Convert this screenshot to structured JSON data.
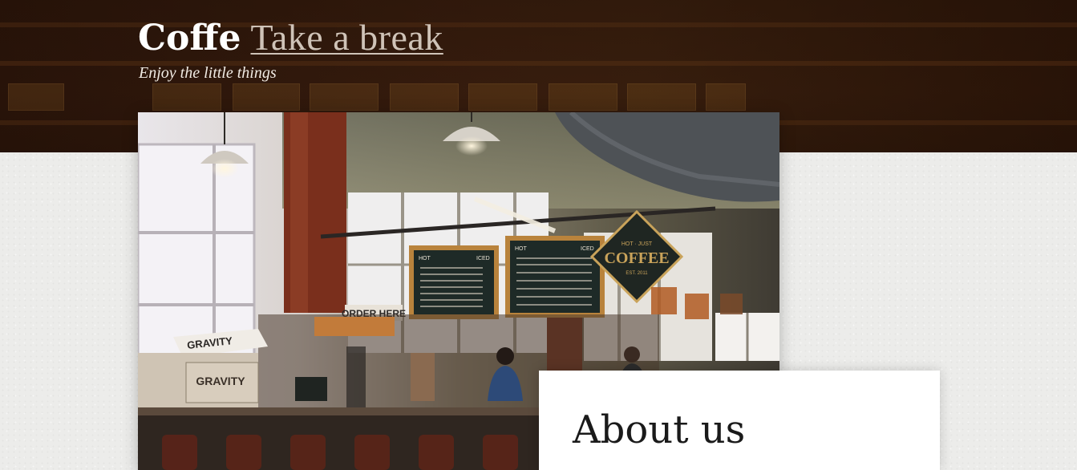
{
  "header": {
    "brand": "Coffe",
    "brand_link": "Take a break",
    "tagline": "Enjoy the little things"
  },
  "photo": {
    "description_icon": "cafe-photo",
    "signs": {
      "coffee_sign": "COFFEE",
      "coffee_sign_top": "HOT · JUST",
      "coffee_sign_bottom": "EST. 2011",
      "order_here": "ORDER HERE",
      "gravity_box": "GRAVITY",
      "gravity_crate": "GRAVITY",
      "menu_left_header_left": "HOT",
      "menu_left_header_right": "ICED",
      "menu_right_header_left": "HOT",
      "menu_right_header_right": "ICED"
    }
  },
  "about": {
    "title": "About us"
  },
  "colors": {
    "header_bg": "#3a1e0f",
    "brand": "#ffffff",
    "brand_link": "#cfc3b8",
    "page_bg": "#ececea"
  }
}
